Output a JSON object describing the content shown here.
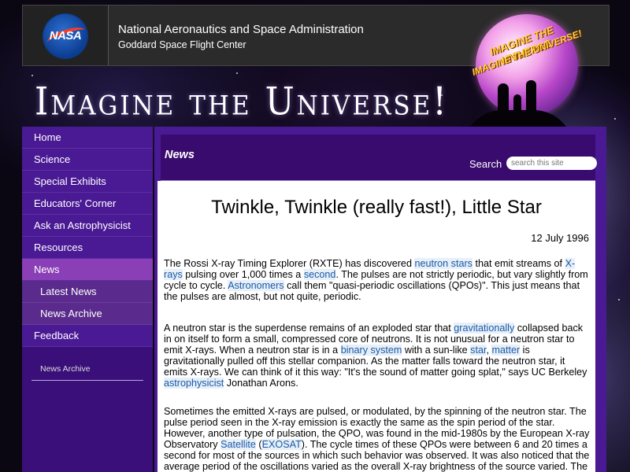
{
  "header": {
    "logo_text": "NASA",
    "agency": "National Aeronautics and Space Administration",
    "center": "Goddard Space Flight Center"
  },
  "banner": {
    "title": "Imagine the Universe!",
    "logo_text_1": "IMAGINE THE UNIVERSE",
    "logo_text_2": "IMAGINE THE UNIVERSE!"
  },
  "sidebar": {
    "items": [
      {
        "label": "Home"
      },
      {
        "label": "Science"
      },
      {
        "label": "Special Exhibits"
      },
      {
        "label": "Educators' Corner"
      },
      {
        "label": "Ask an Astrophysicist"
      },
      {
        "label": "Resources"
      },
      {
        "label": "News"
      },
      {
        "label": "Latest News"
      },
      {
        "label": "News Archive"
      },
      {
        "label": "Feedback"
      }
    ],
    "archive_label": "News Archive"
  },
  "main": {
    "section_title": "News",
    "search_label": "Search",
    "search_placeholder": "search this site"
  },
  "article": {
    "title": "Twinkle, Twinkle (really fast!), Little Star",
    "date": "12 July 1996",
    "p1": [
      {
        "t": "The Rossi X-ray Timing Explorer (RXTE) has discovered "
      },
      {
        "l": "neutron stars"
      },
      {
        "t": " that emit streams of "
      },
      {
        "l": "X-rays"
      },
      {
        "t": " pulsing over 1,000 times a "
      },
      {
        "l": "second"
      },
      {
        "t": ". The pulses are not strictly periodic, but vary slightly from cycle to cycle. "
      },
      {
        "l": "Astronomers"
      },
      {
        "t": " call them \"quasi-periodic oscillations (QPOs)\". This just means that the pulses are almost, but not quite, periodic."
      }
    ],
    "p2": [
      {
        "t": "A neutron star is the superdense remains of an exploded star that "
      },
      {
        "l": "gravitationally"
      },
      {
        "t": " collapsed back in on itself to form a small, compressed core of neutrons. It is not unusual for a neutron star to emit X-rays. When a neutron star is in a "
      },
      {
        "l": "binary system"
      },
      {
        "t": " with a sun-like "
      },
      {
        "l": "star"
      },
      {
        "t": ", "
      },
      {
        "l": "matter"
      },
      {
        "t": " is gravitationally pulled off this stellar companion. As the matter falls toward the neutron star, it emits X-rays. We can think of it this way: \"It's the sound of matter going splat,\" says UC Berkeley "
      },
      {
        "l": "astrophysicist"
      },
      {
        "t": " Jonathan Arons."
      }
    ],
    "p3": [
      {
        "t": "Sometimes the emitted X-rays are pulsed, or modulated, by the spinning of the neutron star. The pulse period seen in the X-ray emission is exactly the same as the spin period of the star. However, another type of pulsation, the QPO, was found in the mid-1980s by the European X-ray Observatory "
      },
      {
        "l": "Satellite"
      },
      {
        "t": " ("
      },
      {
        "l": "EXOSAT"
      },
      {
        "t": "). The cycle times of these QPOs were between 6 and 20 times a second for most of the sources in which such behavior was observed. It was also noticed that the average period of the oscillations varied as the overall X-ray brightness of the source varied. The brighter the source was in X-rays, the shorter the QPO period. Scientists would say this as \"the"
      }
    ]
  }
}
